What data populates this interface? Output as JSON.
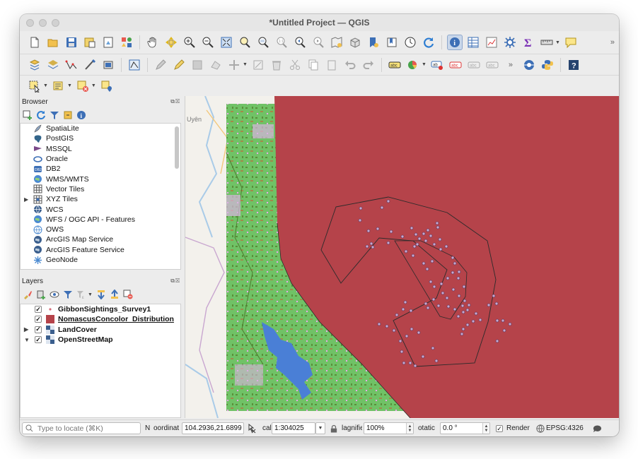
{
  "window": {
    "title": "*Untitled Project — QGIS"
  },
  "toolbars": {
    "row1": [
      "new-project",
      "open-project",
      "save-project",
      "save-as",
      "print-layout",
      "style-manager",
      "pan",
      "pan-to-selection",
      "zoom-in",
      "zoom-out",
      "zoom-full",
      "zoom-to-selection",
      "zoom-to-layer",
      "zoom-native",
      "zoom-last",
      "zoom-next",
      "new-map-view",
      "new-3d-view",
      "temporal-controller",
      "refresh",
      "identify",
      "attribute-table",
      "statistics",
      "processing-toolbox",
      "sum",
      "measure",
      "annotation"
    ],
    "row1_more": "»",
    "row2_more": "»"
  },
  "browser": {
    "title": "Browser",
    "items": [
      {
        "label": "SpatiaLite",
        "icon": "spatialite-icon",
        "expandable": false
      },
      {
        "label": "PostGIS",
        "icon": "postgis-icon",
        "expandable": false
      },
      {
        "label": "MSSQL",
        "icon": "mssql-icon",
        "expandable": false
      },
      {
        "label": "Oracle",
        "icon": "oracle-icon",
        "expandable": false
      },
      {
        "label": "DB2",
        "icon": "db2-icon",
        "expandable": false
      },
      {
        "label": "WMS/WMTS",
        "icon": "wms-icon",
        "expandable": false
      },
      {
        "label": "Vector Tiles",
        "icon": "vector-tiles-icon",
        "expandable": false
      },
      {
        "label": "XYZ Tiles",
        "icon": "xyz-tiles-icon",
        "expandable": true
      },
      {
        "label": "WCS",
        "icon": "wcs-icon",
        "expandable": false
      },
      {
        "label": "WFS / OGC API - Features",
        "icon": "wfs-icon",
        "expandable": false
      },
      {
        "label": "OWS",
        "icon": "ows-icon",
        "expandable": false
      },
      {
        "label": "ArcGIS Map Service",
        "icon": "arcgis-map-icon",
        "expandable": false
      },
      {
        "label": "ArcGIS Feature Service",
        "icon": "arcgis-feature-icon",
        "expandable": false
      },
      {
        "label": "GeoNode",
        "icon": "geonode-icon",
        "expandable": false
      }
    ]
  },
  "layers": {
    "title": "Layers",
    "items": [
      {
        "label": "GibbonSightings_Survey1",
        "checked": true,
        "expandable": false,
        "symbol": "point"
      },
      {
        "label": "NomascusConcolor_Distribution",
        "checked": true,
        "expandable": false,
        "symbol": "polygon",
        "color": "#b5434a",
        "underlined": true
      },
      {
        "label": "LandCover",
        "checked": true,
        "expandable": true,
        "symbol": "raster"
      },
      {
        "label": "OpenStreetMap",
        "checked": true,
        "expandable": true,
        "expanded": true,
        "symbol": "raster"
      }
    ]
  },
  "map": {
    "label": "Uyên",
    "colors": {
      "distribution": "#b5434a",
      "landcover_green": "#70c266",
      "water": "#4a7fd6",
      "basemap": "#f3f1ec"
    }
  },
  "status": {
    "locate_placeholder": "Type to locate (⌘K)",
    "coordinate_label": "oordinat",
    "coordinate_label_prefix": "N",
    "coordinate_value": "104.2936,21.6899",
    "scale_label": "cal",
    "scale_value": "1:304025",
    "magnifier_label": "lagnifie",
    "magnifier_value": "100%",
    "rotation_label": "otatic",
    "rotation_value": "0.0 °",
    "render_label": "Render",
    "render_checked": true,
    "crs": "EPSG:4326"
  }
}
